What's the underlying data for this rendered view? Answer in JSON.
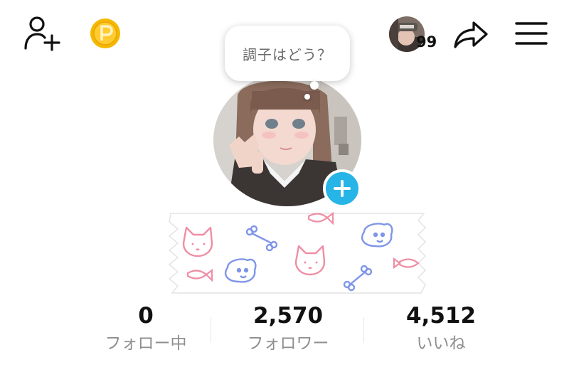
{
  "header": {
    "visitor_count": "99"
  },
  "status_bubble": {
    "text": "調子はどう？"
  },
  "stats": [
    {
      "value": "0",
      "label": "フォロー中"
    },
    {
      "value": "2,570",
      "label": "フォロワー"
    },
    {
      "value": "4,512",
      "label": "いいね"
    }
  ],
  "icons": [
    "add-user-icon",
    "coin-icon",
    "share-icon",
    "menu-icon",
    "plus-icon"
  ],
  "colors": {
    "coin": "#f5b800",
    "add_photo": "#27b4e6",
    "label": "#8e8e8e",
    "cat_pink": "#f08ea4",
    "dog_blue": "#7f95e8"
  }
}
